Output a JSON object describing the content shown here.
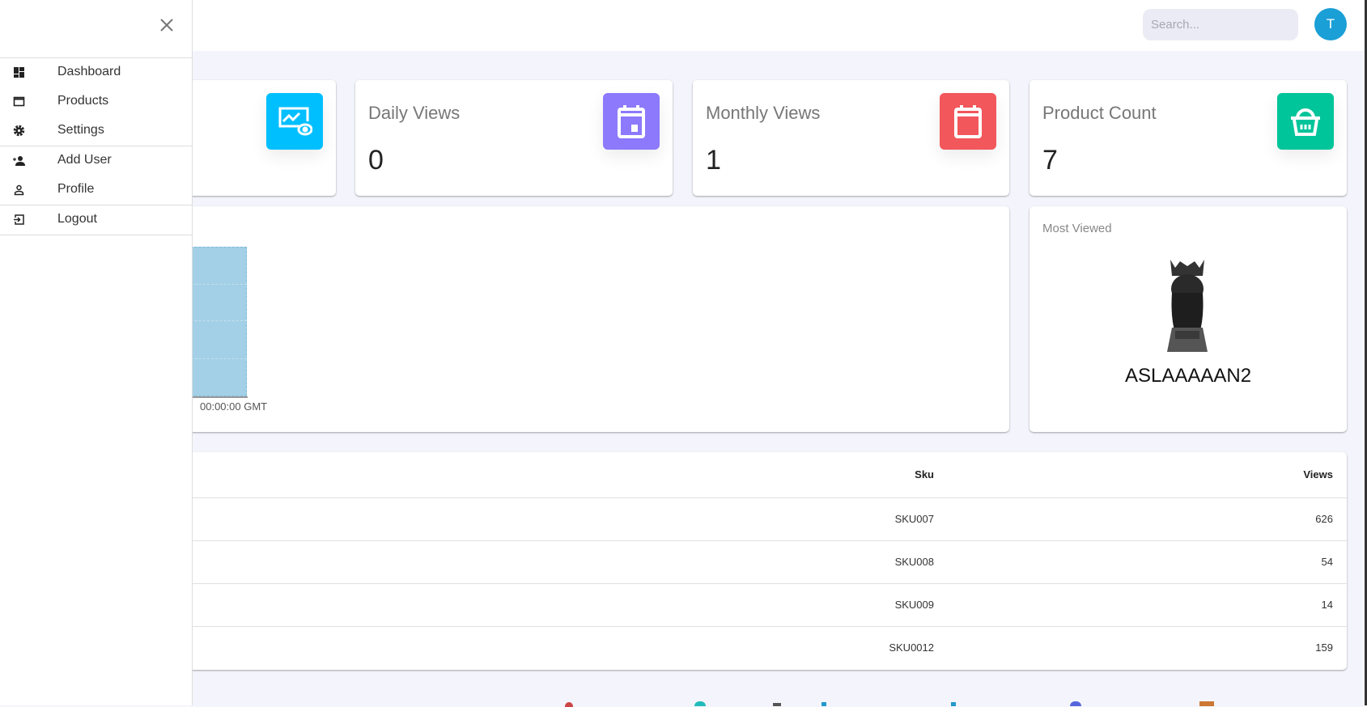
{
  "header": {
    "search_placeholder": "Search...",
    "avatar_initial": "T"
  },
  "sidebar": {
    "items": [
      {
        "label": "Dashboard",
        "icon": "dashboard-icon"
      },
      {
        "label": "Products",
        "icon": "window-icon"
      },
      {
        "label": "Settings",
        "icon": "gear-icon"
      },
      {
        "label": "Add User",
        "icon": "person-add-icon"
      },
      {
        "label": "Profile",
        "icon": "person-icon"
      },
      {
        "label": "Logout",
        "icon": "logout-icon"
      }
    ]
  },
  "stats": [
    {
      "title": "Daily Views",
      "value": "0",
      "color": "#8c79fb",
      "icon": "calendar-today-icon"
    },
    {
      "title": "Monthly Views",
      "value": "1",
      "color": "#f2575b",
      "icon": "calendar-icon"
    },
    {
      "title": "Product Count",
      "value": "7",
      "color": "#00c49a",
      "icon": "basket-icon"
    }
  ],
  "first_stat_icon_color": "#00bfff",
  "chart": {
    "x_label_partial": "00:00:00 GMT",
    "bar_color": "#a3d0e6"
  },
  "most_viewed": {
    "title": "Most Viewed",
    "product_name": "ASLAAAAAN2"
  },
  "table": {
    "columns": [
      "Sku",
      "Views"
    ],
    "rows": [
      {
        "sku": "SKU007",
        "views": "626"
      },
      {
        "sku": "SKU008",
        "views": "54"
      },
      {
        "sku": "SKU009",
        "views": "14"
      },
      {
        "sku": "SKU0012",
        "views": "159"
      }
    ]
  }
}
